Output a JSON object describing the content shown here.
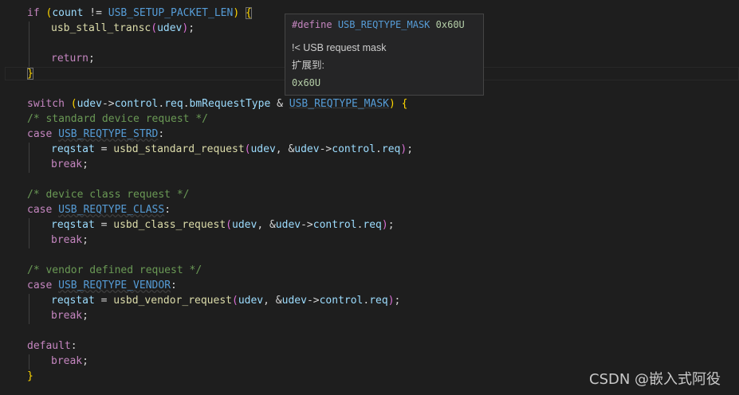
{
  "editor": {
    "if_kw": "if",
    "count": "count",
    "neq": "!=",
    "setup_len": "USB_SETUP_PACKET_LEN",
    "stall_fn": "usb_stall_transc",
    "udev": "udev",
    "ret": "return",
    "switch_kw": "switch",
    "arrow": "->",
    "control": "control",
    "req": "req",
    "bmreq": "bmRequestType",
    "amp": "&",
    "reqtype_mask": "USB_REQTYPE_MASK",
    "c_standard": "/* standard device request */",
    "case_kw": "case",
    "strd": "USB_REQTYPE_STRD",
    "reqstat": "reqstat",
    "std_fn": "usbd_standard_request",
    "brk": "break",
    "c_class": "/* device class request */",
    "class_m": "USB_REQTYPE_CLASS",
    "class_fn": "usbd_class_request",
    "c_vendor": "/* vendor defined request */",
    "vendor_m": "USB_REQTYPE_VENDOR",
    "vendor_fn": "usbd_vendor_request",
    "default_kw": "default"
  },
  "hover": {
    "define_kw": "#define",
    "macro": "USB_REQTYPE_MASK",
    "value": "0x60U",
    "doc": "!< USB request mask",
    "expands": "扩展到:",
    "expanded_value": "0x60U"
  },
  "watermark": "CSDN @嵌入式阿役"
}
